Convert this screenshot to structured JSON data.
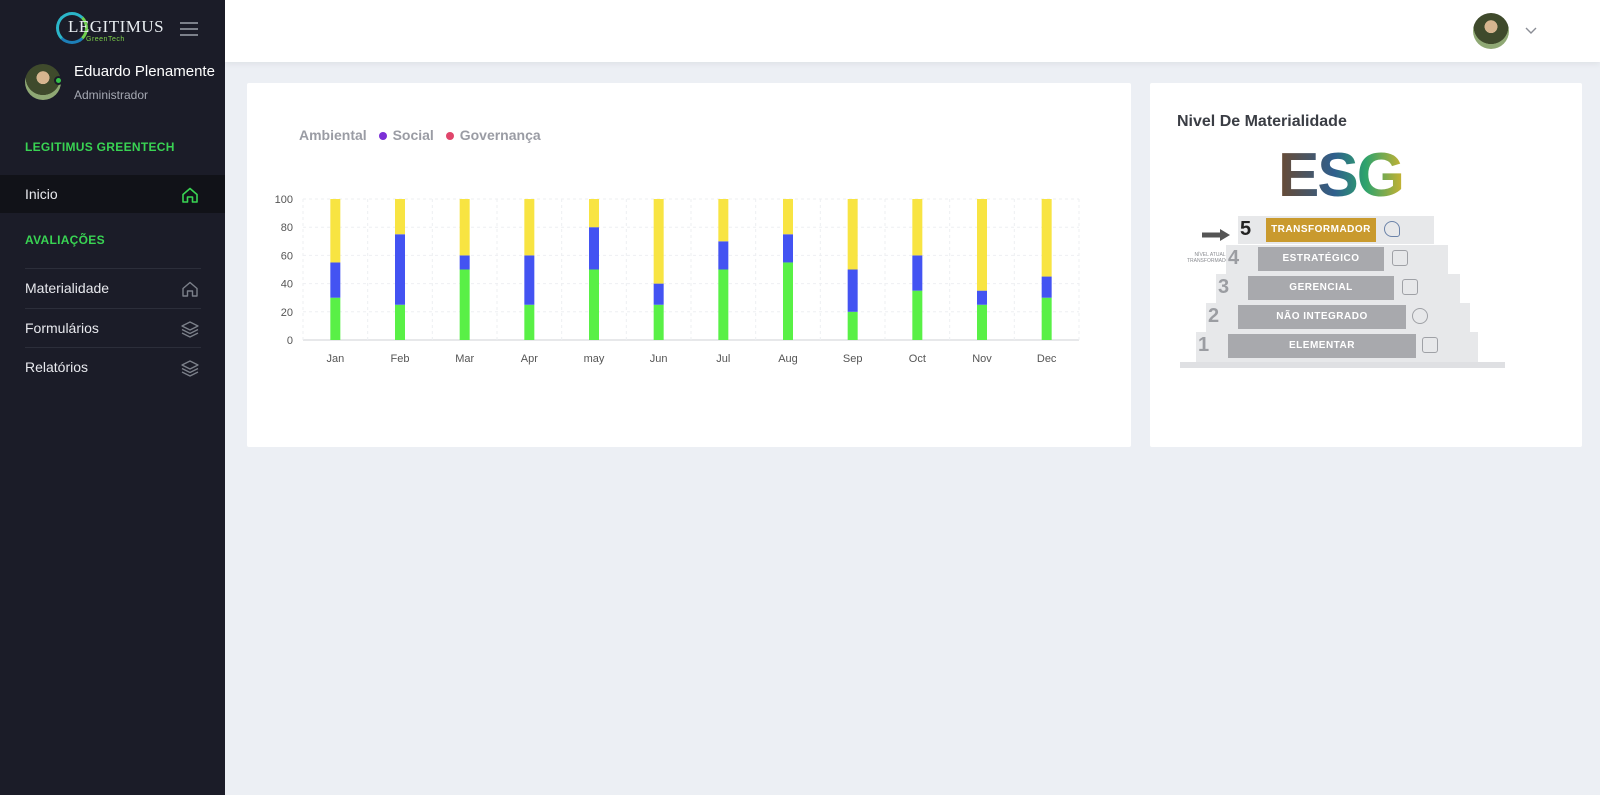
{
  "brand": {
    "name": "LEGITIMUS",
    "sub": "GreenTech"
  },
  "profile": {
    "name": "Eduardo Plenamente",
    "role": "Administrador"
  },
  "sidebar": {
    "section1": "LEGITIMUS GREENTECH",
    "home": {
      "label": "Inicio",
      "icon": "home-icon"
    },
    "section2": "AVALIAÇÕES",
    "items": [
      {
        "label": "Materialidade",
        "icon": "home-icon"
      },
      {
        "label": "Formulários",
        "icon": "layers-icon"
      },
      {
        "label": "Relatórios",
        "icon": "layers-icon"
      }
    ]
  },
  "colors": {
    "ambiental": "#59f046",
    "social": "#4353f2",
    "governanca": "#f8e442",
    "legend_social": "#7b2fd6",
    "legend_governanca": "#e0466b",
    "accent": "#39d353"
  },
  "chart_data": {
    "type": "bar",
    "stacked": true,
    "categories": [
      "Jan",
      "Feb",
      "Mar",
      "Apr",
      "may",
      "Jun",
      "Jul",
      "Aug",
      "Sep",
      "Oct",
      "Nov",
      "Dec"
    ],
    "series": [
      {
        "name": "Ambiental",
        "values": [
          30,
          25,
          50,
          25,
          50,
          25,
          50,
          55,
          20,
          35,
          25,
          30
        ]
      },
      {
        "name": "Social",
        "values": [
          25,
          50,
          10,
          35,
          30,
          15,
          20,
          20,
          30,
          25,
          10,
          15
        ]
      },
      {
        "name": "Governança",
        "values": [
          45,
          25,
          40,
          40,
          20,
          60,
          30,
          25,
          50,
          40,
          65,
          55
        ]
      }
    ],
    "yticks": [
      "0",
      "20",
      "40",
      "60",
      "80",
      "100"
    ],
    "ylim": [
      0,
      100
    ],
    "grid": true,
    "legend_position": "top-left"
  },
  "esg": {
    "title": "Nivel De Materialidade",
    "logo": "ESG",
    "current_label": "NÍVEL ATUAL TRANSFORMADOR",
    "steps": [
      {
        "num": "5",
        "label": "TRANSFORMADOR"
      },
      {
        "num": "4",
        "label": "ESTRATÉGICO"
      },
      {
        "num": "3",
        "label": "GERENCIAL"
      },
      {
        "num": "2",
        "label": "NÃO INTEGRADO"
      },
      {
        "num": "1",
        "label": "ELEMENTAR"
      }
    ]
  }
}
